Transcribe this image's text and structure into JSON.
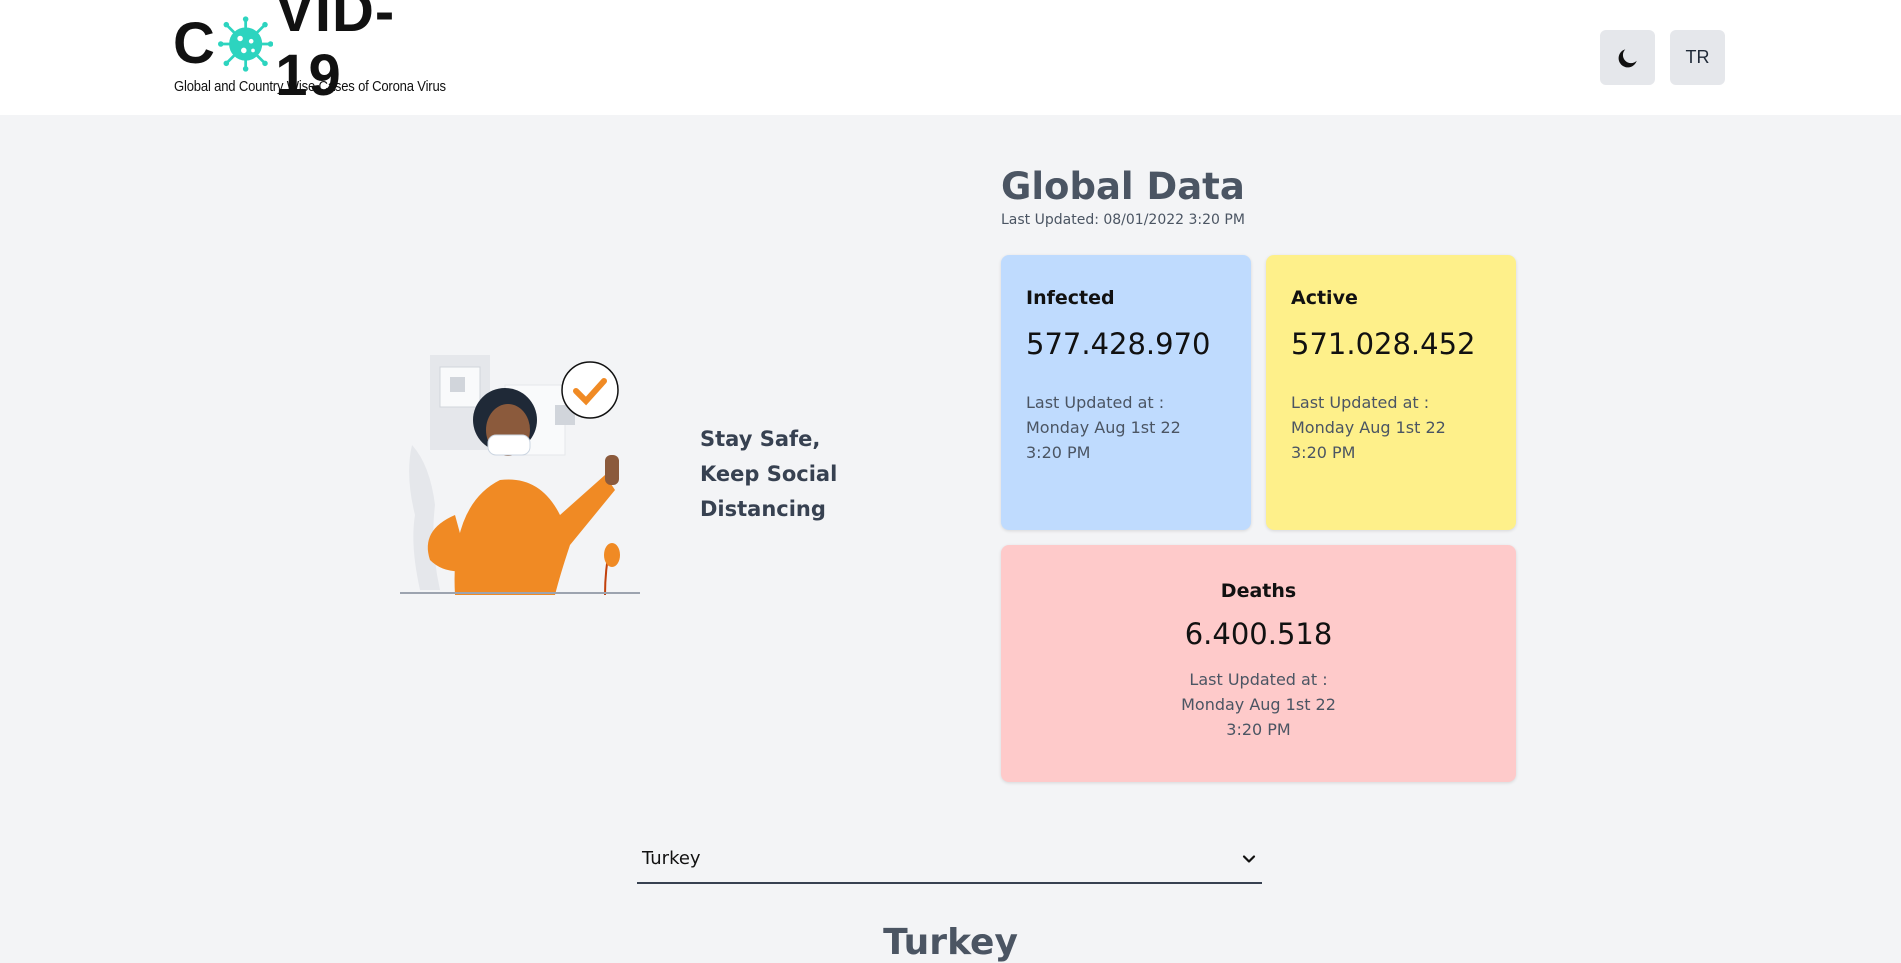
{
  "header": {
    "logo_prefix": "C",
    "logo_suffix": "VID-19",
    "logo_subtitle": "Global and Country Wise Cases of Corona Virus",
    "theme_icon": "moon-icon",
    "language_label": "TR"
  },
  "hero": {
    "slogan_line1": "Stay Safe,",
    "slogan_line2": "Keep Social",
    "slogan_line3": "Distancing"
  },
  "global": {
    "title": "Global Data",
    "last_updated": "Last Updated: 08/01/2022 3:20 PM",
    "cards": {
      "infected": {
        "label": "Infected",
        "value": "577.428.970",
        "updated_line1": "Last Updated at :",
        "updated_line2": "Monday Aug 1st 22",
        "updated_line3": "3:20 PM",
        "color": "#bfdbfe"
      },
      "active": {
        "label": "Active",
        "value": "571.028.452",
        "updated_line1": "Last Updated at :",
        "updated_line2": "Monday Aug 1st 22",
        "updated_line3": "3:20 PM",
        "color": "#fef08a"
      },
      "deaths": {
        "label": "Deaths",
        "value": "6.400.518",
        "updated_line1": "Last Updated at :",
        "updated_line2": "Monday Aug 1st 22",
        "updated_line3": "3:20 PM",
        "color": "#fecaca"
      }
    }
  },
  "country": {
    "selected": "Turkey",
    "heading": "Turkey"
  },
  "colors": {
    "accent_teal": "#2dd4bf",
    "illustration_orange": "#f08a24"
  }
}
